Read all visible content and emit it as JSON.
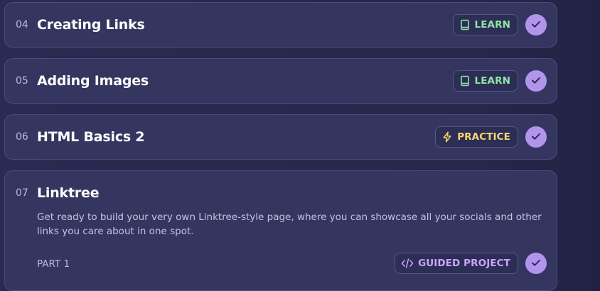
{
  "lessons": [
    {
      "number": "04",
      "title": "Creating Links",
      "badge": {
        "type": "learn",
        "label": "LEARN",
        "icon": "book-icon"
      }
    },
    {
      "number": "05",
      "title": "Adding Images",
      "badge": {
        "type": "learn",
        "label": "LEARN",
        "icon": "book-icon"
      }
    },
    {
      "number": "06",
      "title": "HTML Basics 2",
      "badge": {
        "type": "practice",
        "label": "PRACTICE",
        "icon": "lightning-icon"
      }
    },
    {
      "number": "07",
      "title": "Linktree",
      "description": "Get ready to build your very own Linktree-style page, where you can showcase all your socials and other links you care about in one spot.",
      "part": "PART 1",
      "badge": {
        "type": "guided",
        "label": "GUIDED PROJECT",
        "icon": "code-icon"
      }
    }
  ],
  "colors": {
    "learn": "#8fe3a6",
    "practice": "#f4d66b",
    "guided": "#c9a7ff",
    "check": "#b195ec"
  }
}
